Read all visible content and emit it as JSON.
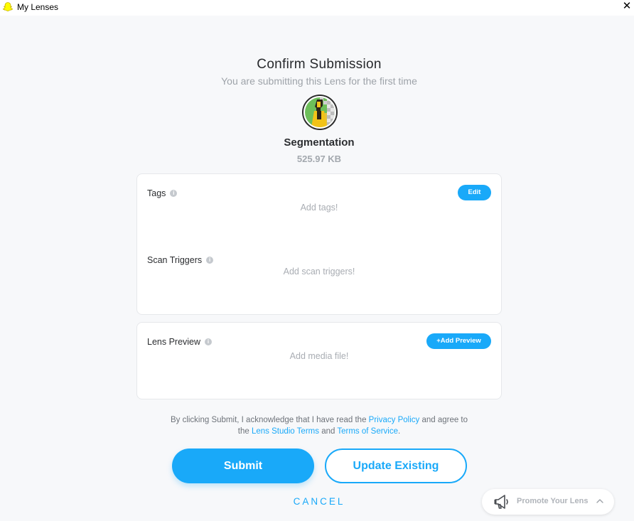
{
  "window": {
    "title": "My Lenses",
    "close_glyph": "✕"
  },
  "header": {
    "title": "Confirm Submission",
    "subtitle": "You are submitting this Lens for the first time"
  },
  "lens": {
    "name": "Segmentation",
    "size": "525.97 KB",
    "icon": "segmentation-lens-icon"
  },
  "tags_section": {
    "label": "Tags",
    "edit_label": "Edit",
    "placeholder": "Add tags!"
  },
  "scan_triggers_section": {
    "label": "Scan Triggers",
    "placeholder": "Add scan triggers!"
  },
  "preview_section": {
    "label": "Lens Preview",
    "add_label": "+Add Preview",
    "placeholder": "Add media file!"
  },
  "consent": {
    "text_1": "By clicking Submit, I acknowledge that I have read the ",
    "privacy_link": "Privacy Policy",
    "text_2": " and agree to",
    "text_3": "the ",
    "studio_terms_link": "Lens Studio Terms",
    "text_4": " and ",
    "tos_link": "Terms of Service",
    "text_5": "."
  },
  "actions": {
    "submit_label": "Submit",
    "update_label": "Update Existing",
    "cancel_label": "CANCEL"
  },
  "promote": {
    "label": "Promote Your Lens",
    "icon": "megaphone-icon"
  },
  "colors": {
    "accent": "#19a9f9",
    "background": "#f7f8fa"
  }
}
